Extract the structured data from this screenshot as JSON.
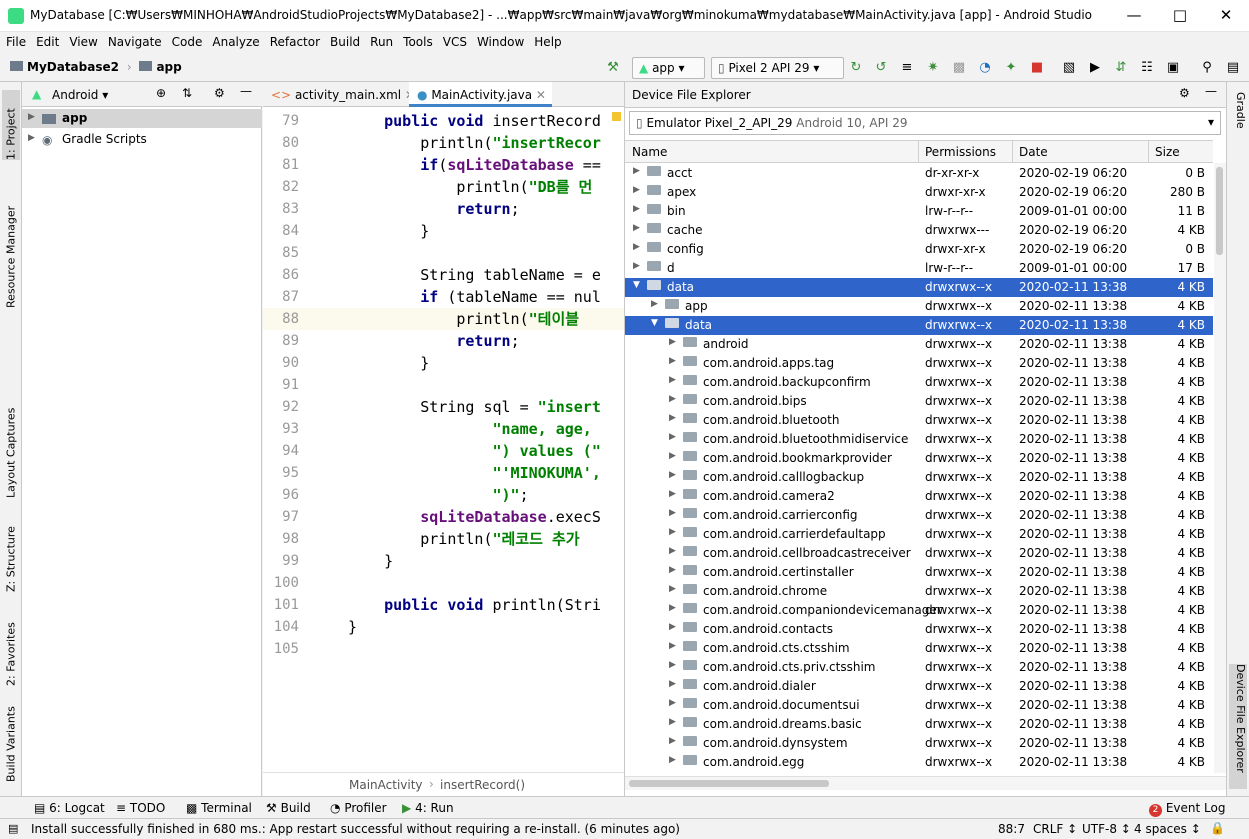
{
  "window": {
    "title": "MyDatabase [C:₩Users₩MINHOHA₩AndroidStudioProjects₩MyDatabase2] - ...₩app₩src₩main₩java₩org₩minokuma₩mydatabase₩MainActivity.java [app] - Android Studio"
  },
  "menu": [
    "File",
    "Edit",
    "View",
    "Navigate",
    "Code",
    "Analyze",
    "Refactor",
    "Build",
    "Run",
    "Tools",
    "VCS",
    "Window",
    "Help"
  ],
  "breadcrumb": {
    "project": "MyDatabase2",
    "module": "app"
  },
  "toolbar": {
    "run_config": "app",
    "device": "Pixel 2 API 29"
  },
  "left_tabs": [
    "1: Project",
    "Resource Manager",
    "Layout Captures",
    "Z: Structure",
    "2: Favorites",
    "Build Variants"
  ],
  "right_tabs": [
    "Gradle",
    "Device File Explorer"
  ],
  "project_panel": {
    "view_mode": "Android",
    "items": [
      {
        "label": "app",
        "bold": true
      },
      {
        "label": "Gradle Scripts",
        "bold": false
      }
    ]
  },
  "editor": {
    "tabs": [
      {
        "label": "activity_main.xml",
        "active": false
      },
      {
        "label": "MainActivity.java",
        "active": true
      }
    ],
    "lines": [
      {
        "n": "79",
        "text": "    public void insertRecord"
      },
      {
        "n": "80",
        "text": "        println(\"insertRecor"
      },
      {
        "n": "81",
        "text": "        if(sqLiteDatabase =="
      },
      {
        "n": "82",
        "text": "            println(\"DB를 먼"
      },
      {
        "n": "83",
        "text": "            return;"
      },
      {
        "n": "84",
        "text": "        }"
      },
      {
        "n": "85",
        "text": ""
      },
      {
        "n": "86",
        "text": "        String tableName = e"
      },
      {
        "n": "87",
        "text": "        if (tableName == nul"
      },
      {
        "n": "88",
        "text": "            println(\"테이블"
      },
      {
        "n": "89",
        "text": "            return;"
      },
      {
        "n": "90",
        "text": "        }"
      },
      {
        "n": "91",
        "text": ""
      },
      {
        "n": "92",
        "text": "        String sql = \"insert"
      },
      {
        "n": "93",
        "text": "                \"name, age,"
      },
      {
        "n": "94",
        "text": "                \") values (\""
      },
      {
        "n": "95",
        "text": "                \"'MINOKUMA',"
      },
      {
        "n": "96",
        "text": "                \")\";"
      },
      {
        "n": "97",
        "text": "        sqLiteDatabase.execS"
      },
      {
        "n": "98",
        "text": "        println(\"레코드 추가"
      },
      {
        "n": "99",
        "text": "    }"
      },
      {
        "n": "100",
        "text": ""
      },
      {
        "n": "101",
        "text": "    public void println(Stri"
      },
      {
        "n": "104",
        "text": "}"
      },
      {
        "n": "105",
        "text": ""
      }
    ],
    "breadcrumb": [
      "MainActivity",
      "insertRecord()"
    ]
  },
  "device_explorer": {
    "title": "Device File Explorer",
    "device": "Emulator Pixel_2_API_29",
    "device_info": "Android 10, API 29",
    "columns": [
      "Name",
      "Permissions",
      "Date",
      "Size"
    ],
    "rows": [
      {
        "indent": 0,
        "name": "acct",
        "perm": "dr-xr-xr-x",
        "date": "2020-02-19 06:20",
        "size": "0 B",
        "sel": false,
        "open": false
      },
      {
        "indent": 0,
        "name": "apex",
        "perm": "drwxr-xr-x",
        "date": "2020-02-19 06:20",
        "size": "280 B",
        "sel": false,
        "open": false
      },
      {
        "indent": 0,
        "name": "bin",
        "perm": "lrw-r--r--",
        "date": "2009-01-01 00:00",
        "size": "11 B",
        "sel": false,
        "open": false
      },
      {
        "indent": 0,
        "name": "cache",
        "perm": "drwxrwx---",
        "date": "2020-02-19 06:20",
        "size": "4 KB",
        "sel": false,
        "open": false
      },
      {
        "indent": 0,
        "name": "config",
        "perm": "drwxr-xr-x",
        "date": "2020-02-19 06:20",
        "size": "0 B",
        "sel": false,
        "open": false
      },
      {
        "indent": 0,
        "name": "d",
        "perm": "lrw-r--r--",
        "date": "2009-01-01 00:00",
        "size": "17 B",
        "sel": false,
        "open": false
      },
      {
        "indent": 0,
        "name": "data",
        "perm": "drwxrwx--x",
        "date": "2020-02-11 13:38",
        "size": "4 KB",
        "sel": true,
        "open": true
      },
      {
        "indent": 1,
        "name": "app",
        "perm": "drwxrwx--x",
        "date": "2020-02-11 13:38",
        "size": "4 KB",
        "sel": false,
        "open": false
      },
      {
        "indent": 1,
        "name": "data",
        "perm": "drwxrwx--x",
        "date": "2020-02-11 13:38",
        "size": "4 KB",
        "sel": true,
        "open": true
      },
      {
        "indent": 2,
        "name": "android",
        "perm": "drwxrwx--x",
        "date": "2020-02-11 13:38",
        "size": "4 KB",
        "sel": false,
        "open": false
      },
      {
        "indent": 2,
        "name": "com.android.apps.tag",
        "perm": "drwxrwx--x",
        "date": "2020-02-11 13:38",
        "size": "4 KB",
        "sel": false,
        "open": false
      },
      {
        "indent": 2,
        "name": "com.android.backupconfirm",
        "perm": "drwxrwx--x",
        "date": "2020-02-11 13:38",
        "size": "4 KB",
        "sel": false,
        "open": false
      },
      {
        "indent": 2,
        "name": "com.android.bips",
        "perm": "drwxrwx--x",
        "date": "2020-02-11 13:38",
        "size": "4 KB",
        "sel": false,
        "open": false
      },
      {
        "indent": 2,
        "name": "com.android.bluetooth",
        "perm": "drwxrwx--x",
        "date": "2020-02-11 13:38",
        "size": "4 KB",
        "sel": false,
        "open": false
      },
      {
        "indent": 2,
        "name": "com.android.bluetoothmidiservice",
        "perm": "drwxrwx--x",
        "date": "2020-02-11 13:38",
        "size": "4 KB",
        "sel": false,
        "open": false
      },
      {
        "indent": 2,
        "name": "com.android.bookmarkprovider",
        "perm": "drwxrwx--x",
        "date": "2020-02-11 13:38",
        "size": "4 KB",
        "sel": false,
        "open": false
      },
      {
        "indent": 2,
        "name": "com.android.calllogbackup",
        "perm": "drwxrwx--x",
        "date": "2020-02-11 13:38",
        "size": "4 KB",
        "sel": false,
        "open": false
      },
      {
        "indent": 2,
        "name": "com.android.camera2",
        "perm": "drwxrwx--x",
        "date": "2020-02-11 13:38",
        "size": "4 KB",
        "sel": false,
        "open": false
      },
      {
        "indent": 2,
        "name": "com.android.carrierconfig",
        "perm": "drwxrwx--x",
        "date": "2020-02-11 13:38",
        "size": "4 KB",
        "sel": false,
        "open": false
      },
      {
        "indent": 2,
        "name": "com.android.carrierdefaultapp",
        "perm": "drwxrwx--x",
        "date": "2020-02-11 13:38",
        "size": "4 KB",
        "sel": false,
        "open": false
      },
      {
        "indent": 2,
        "name": "com.android.cellbroadcastreceiver",
        "perm": "drwxrwx--x",
        "date": "2020-02-11 13:38",
        "size": "4 KB",
        "sel": false,
        "open": false
      },
      {
        "indent": 2,
        "name": "com.android.certinstaller",
        "perm": "drwxrwx--x",
        "date": "2020-02-11 13:38",
        "size": "4 KB",
        "sel": false,
        "open": false
      },
      {
        "indent": 2,
        "name": "com.android.chrome",
        "perm": "drwxrwx--x",
        "date": "2020-02-11 13:38",
        "size": "4 KB",
        "sel": false,
        "open": false
      },
      {
        "indent": 2,
        "name": "com.android.companiondevicemanager",
        "perm": "drwxrwx--x",
        "date": "2020-02-11 13:38",
        "size": "4 KB",
        "sel": false,
        "open": false
      },
      {
        "indent": 2,
        "name": "com.android.contacts",
        "perm": "drwxrwx--x",
        "date": "2020-02-11 13:38",
        "size": "4 KB",
        "sel": false,
        "open": false
      },
      {
        "indent": 2,
        "name": "com.android.cts.ctsshim",
        "perm": "drwxrwx--x",
        "date": "2020-02-11 13:38",
        "size": "4 KB",
        "sel": false,
        "open": false
      },
      {
        "indent": 2,
        "name": "com.android.cts.priv.ctsshim",
        "perm": "drwxrwx--x",
        "date": "2020-02-11 13:38",
        "size": "4 KB",
        "sel": false,
        "open": false
      },
      {
        "indent": 2,
        "name": "com.android.dialer",
        "perm": "drwxrwx--x",
        "date": "2020-02-11 13:38",
        "size": "4 KB",
        "sel": false,
        "open": false
      },
      {
        "indent": 2,
        "name": "com.android.documentsui",
        "perm": "drwxrwx--x",
        "date": "2020-02-11 13:38",
        "size": "4 KB",
        "sel": false,
        "open": false
      },
      {
        "indent": 2,
        "name": "com.android.dreams.basic",
        "perm": "drwxrwx--x",
        "date": "2020-02-11 13:38",
        "size": "4 KB",
        "sel": false,
        "open": false
      },
      {
        "indent": 2,
        "name": "com.android.dynsystem",
        "perm": "drwxrwx--x",
        "date": "2020-02-11 13:38",
        "size": "4 KB",
        "sel": false,
        "open": false
      },
      {
        "indent": 2,
        "name": "com.android.egg",
        "perm": "drwxrwx--x",
        "date": "2020-02-11 13:38",
        "size": "4 KB",
        "sel": false,
        "open": false
      }
    ]
  },
  "bottom_tabs": [
    "6: Logcat",
    "TODO",
    "Terminal",
    "Build",
    "Profiler",
    "4: Run"
  ],
  "event_log": {
    "label": "Event Log",
    "count": "2"
  },
  "status": {
    "message": "Install successfully finished in 680 ms.: App restart successful without requiring a re-install. (6 minutes ago)",
    "position": "88:7",
    "line_sep": "CRLF",
    "encoding": "UTF-8",
    "indent": "4 spaces"
  },
  "colors": {
    "selection": "#2f65ca",
    "keyword": "#000080",
    "string": "#008000",
    "field": "#660e7a"
  }
}
